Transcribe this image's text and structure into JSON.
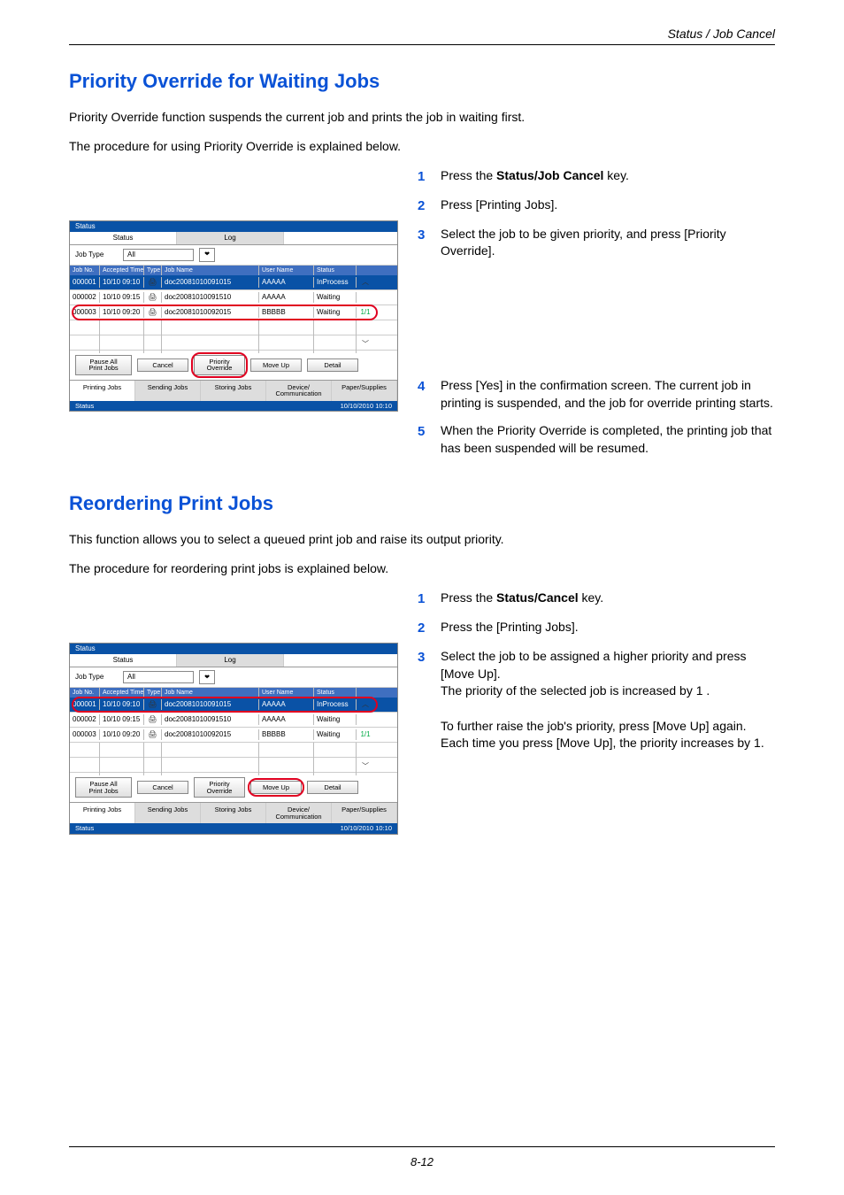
{
  "header": {
    "section": "Status / Job Cancel"
  },
  "sec1": {
    "title": "Priority Override for Waiting Jobs",
    "p1": "Priority Override function suspends the current job and prints the job in waiting first.",
    "p2": "The procedure for using Priority Override is explained below.",
    "steps": [
      {
        "n": "1",
        "t_pre": "Press the ",
        "t_bold": "Status/Job Cancel",
        "t_post": " key."
      },
      {
        "n": "2",
        "t": "Press [Printing Jobs]."
      },
      {
        "n": "3",
        "t": "Select the job to be given priority, and press [Priority Override]."
      },
      {
        "n": "4",
        "t": "Press [Yes] in the confirmation screen. The current job in printing is suspended, and the job for override printing starts."
      },
      {
        "n": "5",
        "t": "When the Priority Override is completed, the printing job that has been suspended will be resumed."
      }
    ]
  },
  "sec2": {
    "title": "Reordering Print Jobs",
    "p1": "This function allows you to select a queued print job and raise its output priority.",
    "p2": "The procedure for reordering print jobs is explained below.",
    "steps": [
      {
        "n": "1",
        "t_pre": "Press the ",
        "t_bold": "Status/Cancel",
        "t_post": " key."
      },
      {
        "n": "2",
        "t": "Press the [Printing Jobs]."
      },
      {
        "n": "3",
        "t": "Select the job to be assigned a higher priority and press [Move Up].\nThe priority of the selected job is increased by 1 .\n\nTo further raise the job's priority, press [Move Up] again. Each time you press [Move Up], the priority increases by 1."
      }
    ]
  },
  "panel": {
    "titlebar": "Status",
    "tab_status": "Status",
    "tab_log": "Log",
    "jobtype_lbl": "Job Type",
    "jobtype_val": "All",
    "cols": {
      "no": "Job No.",
      "time": "Accepted Time",
      "type": "Type",
      "name": "Job Name",
      "user": "User Name",
      "status": "Status"
    },
    "rows": [
      {
        "no": "000001",
        "time": "10/10 09:10",
        "name": "doc20081010091015",
        "user": "AAAAA",
        "status": "InProcess"
      },
      {
        "no": "000002",
        "time": "10/10 09:15",
        "name": "doc20081010091510",
        "user": "AAAAA",
        "status": "Waiting"
      },
      {
        "no": "000003",
        "time": "10/10 09:20",
        "name": "doc20081010092015",
        "user": "BBBBB",
        "status": "Waiting"
      }
    ],
    "pager": "1/1",
    "btn_pause": "Pause All\nPrint Jobs",
    "btn_cancel": "Cancel",
    "btn_priority": "Priority\nOverride",
    "btn_moveup": "Move Up",
    "btn_detail": "Detail",
    "btab_printing": "Printing Jobs",
    "btab_sending": "Sending Jobs",
    "btab_storing": "Storing Jobs",
    "btab_device": "Device/\nCommunication",
    "btab_paper": "Paper/Supplies",
    "status_left": "Status",
    "status_right": "10/10/2010 10:10"
  },
  "chart_data": {
    "type": "table",
    "title": "Printing Jobs status list",
    "columns": [
      "Job No.",
      "Accepted Time",
      "Type",
      "Job Name",
      "User Name",
      "Status"
    ],
    "rows": [
      [
        "000001",
        "10/10 09:10",
        "print-icon",
        "doc20081010091015",
        "AAAAA",
        "InProcess"
      ],
      [
        "000002",
        "10/10 09:15",
        "print-icon",
        "doc20081010091510",
        "AAAAA",
        "Waiting"
      ],
      [
        "000003",
        "10/10 09:20",
        "print-icon",
        "doc20081010092015",
        "BBBBB",
        "Waiting"
      ]
    ]
  },
  "footer": {
    "pagenum": "8-12"
  }
}
